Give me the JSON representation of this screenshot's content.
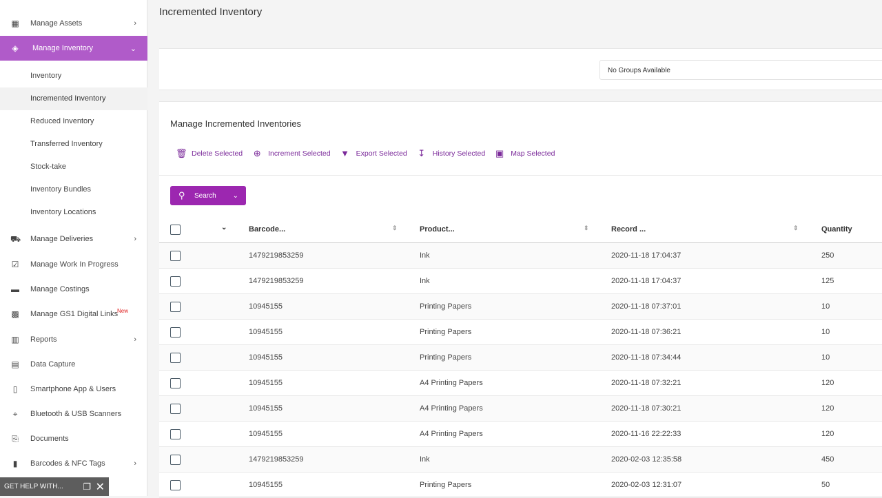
{
  "sidebar": {
    "items": [
      {
        "label": "Manage Assets",
        "icon": "buildings-icon",
        "chevron": "›"
      },
      {
        "label": "Manage Inventory",
        "icon": "tag-icon",
        "chevron": "⌄"
      },
      {
        "label": "Manage Deliveries",
        "icon": "truck-icon",
        "chevron": "›"
      },
      {
        "label": "Manage Work In Progress",
        "icon": "clipboard-check-icon"
      },
      {
        "label": "Manage Costings",
        "icon": "cash-register-icon"
      },
      {
        "label": "Manage GS1 Digital Links",
        "icon": "qr-code-icon",
        "badge": "New"
      },
      {
        "label": "Reports",
        "icon": "bar-chart-icon",
        "chevron": "›"
      },
      {
        "label": "Data Capture",
        "icon": "clipboard-icon"
      },
      {
        "label": "Smartphone App & Users",
        "icon": "smartphone-icon"
      },
      {
        "label": "Bluetooth & USB Scanners",
        "icon": "crosshair-icon"
      },
      {
        "label": "Documents",
        "icon": "file-upload-icon"
      },
      {
        "label": "Barcodes & NFC Tags",
        "icon": "barcode-icon",
        "chevron": "›"
      }
    ],
    "subitems": [
      "Inventory",
      "Incremented Inventory",
      "Reduced Inventory",
      "Transferred Inventory",
      "Stock-take",
      "Inventory Bundles",
      "Inventory Locations"
    ],
    "selected_subitem": "Incremented Inventory",
    "accent": "#b05bc9"
  },
  "help": {
    "label": "GET HELP WITH...",
    "icons": [
      "window-restore-icon",
      "close-icon"
    ]
  },
  "page": {
    "title": "Incremented Inventory",
    "groups_select": "No Groups Available"
  },
  "panel": {
    "title": "Manage Incremented Inventories",
    "actions": [
      {
        "label": "Delete Selected",
        "icon": "trash-icon"
      },
      {
        "label": "Increment Selected",
        "icon": "plus-circle-icon"
      },
      {
        "label": "Export Selected",
        "icon": "file-export-icon"
      },
      {
        "label": "History Selected",
        "icon": "history-icon"
      },
      {
        "label": "Map Selected",
        "icon": "map-icon"
      }
    ],
    "search_label": "Search",
    "accent": "#9c27b0"
  },
  "table": {
    "columns": [
      "Barcode...",
      "Product...",
      "Record ...",
      "Quantity"
    ],
    "rows": [
      [
        "1479219853259",
        "Ink",
        "2020-11-18 17:04:37",
        "250"
      ],
      [
        "1479219853259",
        "Ink",
        "2020-11-18 17:04:37",
        "125"
      ],
      [
        "10945155",
        "Printing Papers",
        "2020-11-18 07:37:01",
        "10"
      ],
      [
        "10945155",
        "Printing Papers",
        "2020-11-18 07:36:21",
        "10"
      ],
      [
        "10945155",
        "Printing Papers",
        "2020-11-18 07:34:44",
        "10"
      ],
      [
        "10945155",
        "A4 Printing Papers",
        "2020-11-18 07:32:21",
        "120"
      ],
      [
        "10945155",
        "A4 Printing Papers",
        "2020-11-18 07:30:21",
        "120"
      ],
      [
        "10945155",
        "A4 Printing Papers",
        "2020-11-16 22:22:33",
        "120"
      ],
      [
        "1479219853259",
        "Ink",
        "2020-02-03 12:35:58",
        "450"
      ],
      [
        "10945155",
        "Printing Papers",
        "2020-02-03 12:31:07",
        "50"
      ]
    ]
  }
}
